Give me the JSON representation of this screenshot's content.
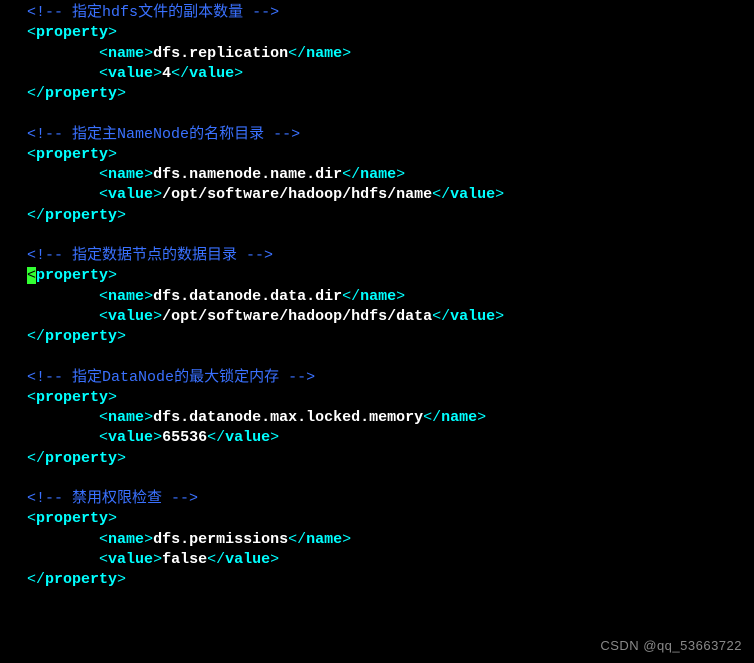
{
  "comments": {
    "c1_prefix": "<!-- ",
    "c1_mid1": "指定",
    "c1_word": "hdfs",
    "c1_mid2": "文件的副本数量",
    "c1_suffix": " -->",
    "c2_prefix": "<!-- ",
    "c2_mid1": "指定主",
    "c2_word": "NameNode",
    "c2_mid2": "的名称目录",
    "c2_suffix": " -->",
    "c3_prefix": "<!-- ",
    "c3_text": "指定数据节点的数据目录",
    "c3_suffix": " -->",
    "c4_prefix": "<!-- ",
    "c4_mid1": "指定",
    "c4_word": "DataNode",
    "c4_mid2": "的最大锁定内存",
    "c4_suffix": " -->",
    "c5_prefix": "<!-- ",
    "c5_text": "禁用权限检查",
    "c5_suffix": " -->"
  },
  "tags": {
    "prop_open_lt": "<",
    "prop_open_name": "property",
    "prop_open_gt": ">",
    "prop_close_lt": "</",
    "prop_close_name": "property",
    "prop_close_gt": ">",
    "name_open_lt": "<",
    "name_open_name": "name",
    "name_open_gt": ">",
    "name_close_lt": "</",
    "name_close_name": "name",
    "name_close_gt": ">",
    "value_open_lt": "<",
    "value_open_name": "value",
    "value_open_gt": ">",
    "value_close_lt": "</",
    "value_close_name": "value",
    "value_close_gt": ">"
  },
  "props": {
    "p1_name": "dfs.replication",
    "p1_value": "4",
    "p2_name": "dfs.namenode.name.dir",
    "p2_value": "/opt/software/hadoop/hdfs/name",
    "p3_name": "dfs.datanode.data.dir",
    "p3_value": "/opt/software/hadoop/hdfs/data",
    "p4_name": "dfs.datanode.max.locked.memory",
    "p4_value": "65536",
    "p5_name": "dfs.permissions",
    "p5_value": "false"
  },
  "indent": {
    "lvl1": "   ",
    "lvl2": "           "
  },
  "cursor": "<",
  "watermark": "CSDN @qq_53663722"
}
